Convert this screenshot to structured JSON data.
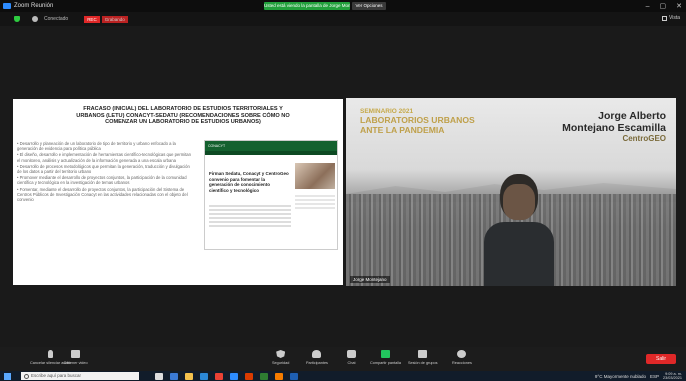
{
  "window": {
    "title": "Zoom Reunión",
    "share_notice": "Usted está viendo la pantalla de Jorge Montejano",
    "view_options": "Ver Opciones"
  },
  "meeting": {
    "participant": "Conectado",
    "rec_label": "REC",
    "rec_status": "Grabando",
    "view_label": "Vista"
  },
  "slide": {
    "title": "FRACASO (INICIAL) DEL LABORATORIO DE ESTUDIOS TERRITORIALES Y URBANOS (LETU) CONACYT-SEDATU (RECOMENDACIONES SOBRE CÓMO NO COMENZAR UN LABORATORIO DE ESTUDIOS URBANOS)",
    "bullets": [
      "Desarrollo y planeación de un laboratorio de tipo de territorio y urbano enfocado a la generación de evidencia para política pública",
      "El diseño, desarrollo e implementación de herramientas científico-tecnológicas que permitan el monitoreo, análisis y actualización de la información generada a una escala urbana",
      "Desarrollo de procesos metodológicos que permitan la generación, traducción y divulgación de los datos a partir del territorio urbano",
      "Promover mediante el desarrollo de proyectos conjuntos, la participación de la comunidad científica y tecnológica en la investigación de temas urbanos",
      "Fomentar, mediante el desarrollo de proyectos conjuntos, la participación del Sistema de Centros Públicos de Investigación Conacyt en las actividades relacionadas con el objeto del convenio"
    ],
    "embedded": {
      "logo": "CONACYT",
      "title": "Firman Sedatu, Conacyt y CentroGeo convenio para fomentar la generación de conocimiento científico y tecnológico"
    }
  },
  "video": {
    "event_line": "SEMINARIO 2021",
    "event_title_1": "LABORATORIOS URBANOS",
    "event_title_2": "ANTE LA PANDEMIA",
    "speaker_name_1": "Jorge Alberto",
    "speaker_name_2": "Montejano Escamilla",
    "organization": "CentroGEO",
    "name_tag": "Jorge Montejano"
  },
  "toolbar": {
    "mute": "Cancelar silenciar audio",
    "video": "Detener video",
    "security": "Seguridad",
    "participants": "Participantes",
    "chat": "Chat",
    "share": "Compartir pantalla",
    "record": "Sesión de grupos",
    "reactions": "Reacciones",
    "leave": "Salir"
  },
  "taskbar": {
    "search_placeholder": "Escribe aquí para buscar",
    "weather": "9°C Mayormente nublado",
    "time": "9:09 a. m.",
    "date": "23/03/2021",
    "lang": "ESP"
  },
  "colors": {
    "share_green": "#22a03c",
    "rec_red": "#e02828",
    "embed_green": "#14612f",
    "overlay_gold": "#c6a94a"
  }
}
